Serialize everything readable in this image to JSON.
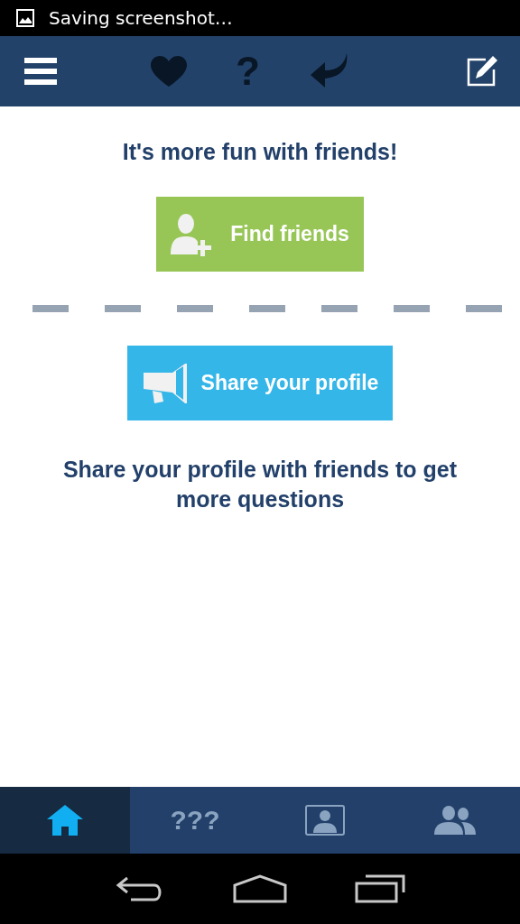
{
  "status_bar": {
    "notification": "Saving screenshot…"
  },
  "toolbar": {
    "items": [
      {
        "kind": "menu"
      },
      {
        "kind": "heart"
      },
      {
        "kind": "text",
        "label": "?"
      },
      {
        "kind": "reply"
      },
      {
        "kind": "edit"
      }
    ]
  },
  "content": {
    "heading": "It's more fun with friends!",
    "buttons": [
      {
        "kind": "find",
        "label": "Find friends"
      },
      {
        "kind": "share",
        "label": "Share your profile"
      }
    ],
    "note": "Share your profile with friends to get more questions"
  },
  "bottom_tabs": [
    {
      "kind": "home",
      "selected": true
    },
    {
      "kind": "text",
      "label": "???",
      "selected": false
    },
    {
      "kind": "profile",
      "selected": false
    },
    {
      "kind": "group",
      "selected": false
    }
  ]
}
